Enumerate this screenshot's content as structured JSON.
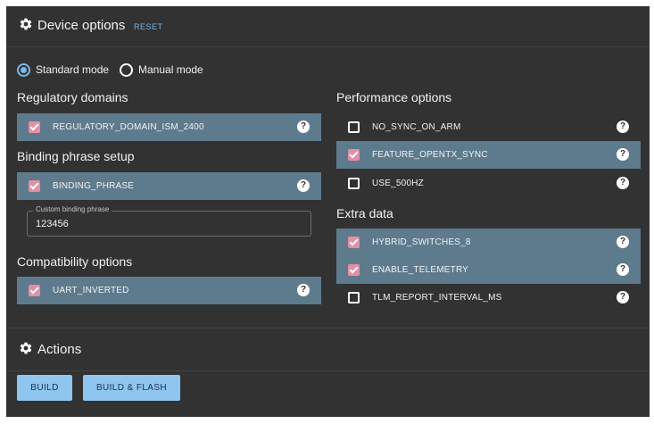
{
  "device_options": {
    "title": "Device options",
    "reset_label": "RESET"
  },
  "modes": {
    "standard_label": "Standard mode",
    "manual_label": "Manual mode",
    "selected": "standard"
  },
  "regulatory": {
    "title": "Regulatory domains",
    "items": [
      {
        "label": "REGULATORY_DOMAIN_ISM_2400",
        "checked": true
      }
    ]
  },
  "binding": {
    "title": "Binding phrase setup",
    "items": [
      {
        "label": "BINDING_PHRASE",
        "checked": true
      }
    ],
    "field_label": "Custom binding phrase",
    "field_value": "123456"
  },
  "compatibility": {
    "title": "Compatibility options",
    "items": [
      {
        "label": "UART_INVERTED",
        "checked": true
      }
    ]
  },
  "performance": {
    "title": "Performance options",
    "items": [
      {
        "label": "NO_SYNC_ON_ARM",
        "checked": false
      },
      {
        "label": "FEATURE_OPENTX_SYNC",
        "checked": true
      },
      {
        "label": "USE_500HZ",
        "checked": false
      }
    ]
  },
  "extra": {
    "title": "Extra data",
    "items": [
      {
        "label": "HYBRID_SWITCHES_8",
        "checked": true
      },
      {
        "label": "ENABLE_TELEMETRY",
        "checked": true
      },
      {
        "label": "TLM_REPORT_INTERVAL_MS",
        "checked": false
      }
    ]
  },
  "actions": {
    "title": "Actions",
    "build_label": "BUILD",
    "build_flash_label": "BUILD & FLASH"
  },
  "icons": {
    "header": "gear-icon",
    "help": "help-circle-icon"
  },
  "help_glyph": "?",
  "colors": {
    "panel": "#323232",
    "checked_row": "#5e7b8e",
    "checkbox": "#e48fa5",
    "accent": "#79b3e0",
    "button": "#8ec6f0"
  }
}
